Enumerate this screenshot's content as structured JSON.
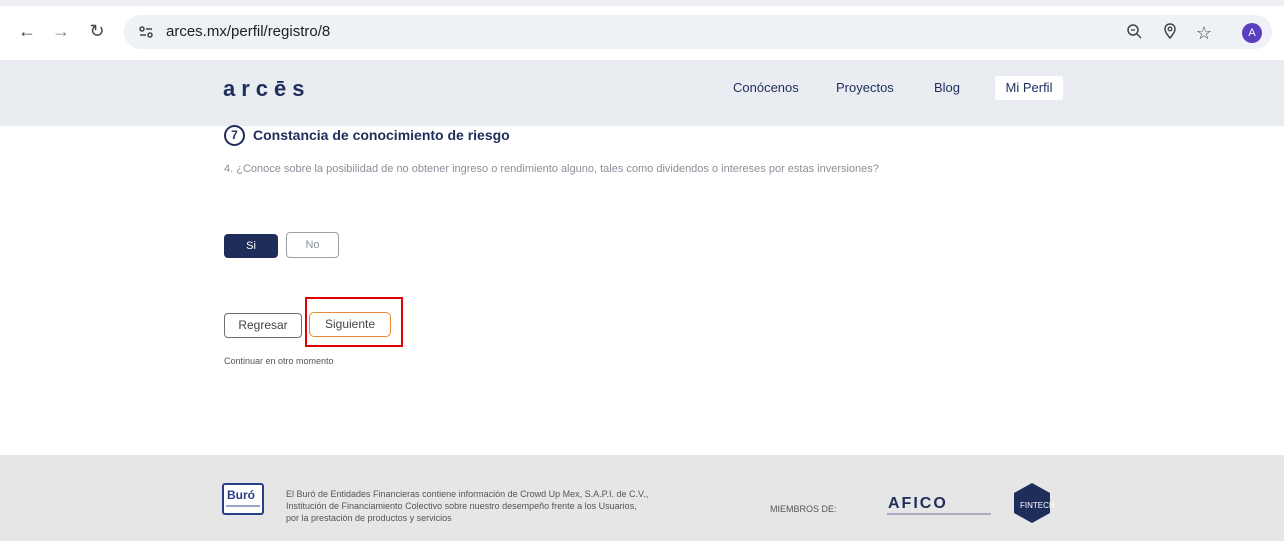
{
  "browser": {
    "url": "arces.mx/perfil/registro/8",
    "avatar_letter": "A",
    "icons": [
      "back-icon",
      "forward-icon",
      "reload-icon",
      "site-settings-icon",
      "zoom-icon",
      "location-icon",
      "bookmark-star-icon"
    ]
  },
  "header": {
    "logo": "arcēs",
    "nav": [
      "Conócenos",
      "Proyectos",
      "Blog",
      "Mi Perfil"
    ]
  },
  "step": {
    "number": "7",
    "title": "Constancia de conocimiento de riesgo",
    "question": "4. ¿Conoce sobre la posibilidad de no obtener ingreso o rendimiento alguno, tales como dividendos o intereses por estas inversiones?"
  },
  "options": {
    "yes": "Si",
    "no": "No",
    "selected": "Si"
  },
  "actions": {
    "back": "Regresar",
    "next": "Siguiente",
    "later": "Continuar en otro momento"
  },
  "footer": {
    "buro_logo": "Buró",
    "lines": [
      "El Buró de Entidades Financieras contiene información de Crowd Up Mex, S.A.P.I. de C.V.,",
      "Institución de Financiamiento Colectivo sobre nuestro desempeño frente a los Usuarios,",
      "por la prestación de productos y servicios"
    ],
    "members_label": "MIEMBROS DE:",
    "afico": "AFICO",
    "fintech": "FINTECH"
  },
  "colors": {
    "navy": "#1f2d5a",
    "accent_orange": "#e58a2e",
    "highlight_red": "#e10000"
  }
}
